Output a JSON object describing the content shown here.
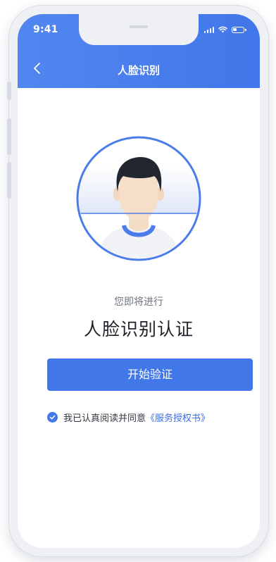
{
  "status_bar": {
    "time": "9:41",
    "icons": [
      "signal-icon",
      "wifi-icon",
      "battery-icon"
    ]
  },
  "nav": {
    "back_icon": "chevron-left-icon",
    "title": "人脸识别"
  },
  "main": {
    "subtitle": "您即将进行",
    "title": "人脸识别认证",
    "start_button": "开始验证"
  },
  "agreement": {
    "text": "我已认真阅读并同意",
    "link": "《服务授权书》",
    "checked": true
  },
  "colors": {
    "accent": "#4277ea",
    "header_start": "#5286ef",
    "header_end": "#4176ea",
    "link": "#3e6fe0",
    "title_text": "#1f2329",
    "subtitle_text": "#6f7580"
  }
}
